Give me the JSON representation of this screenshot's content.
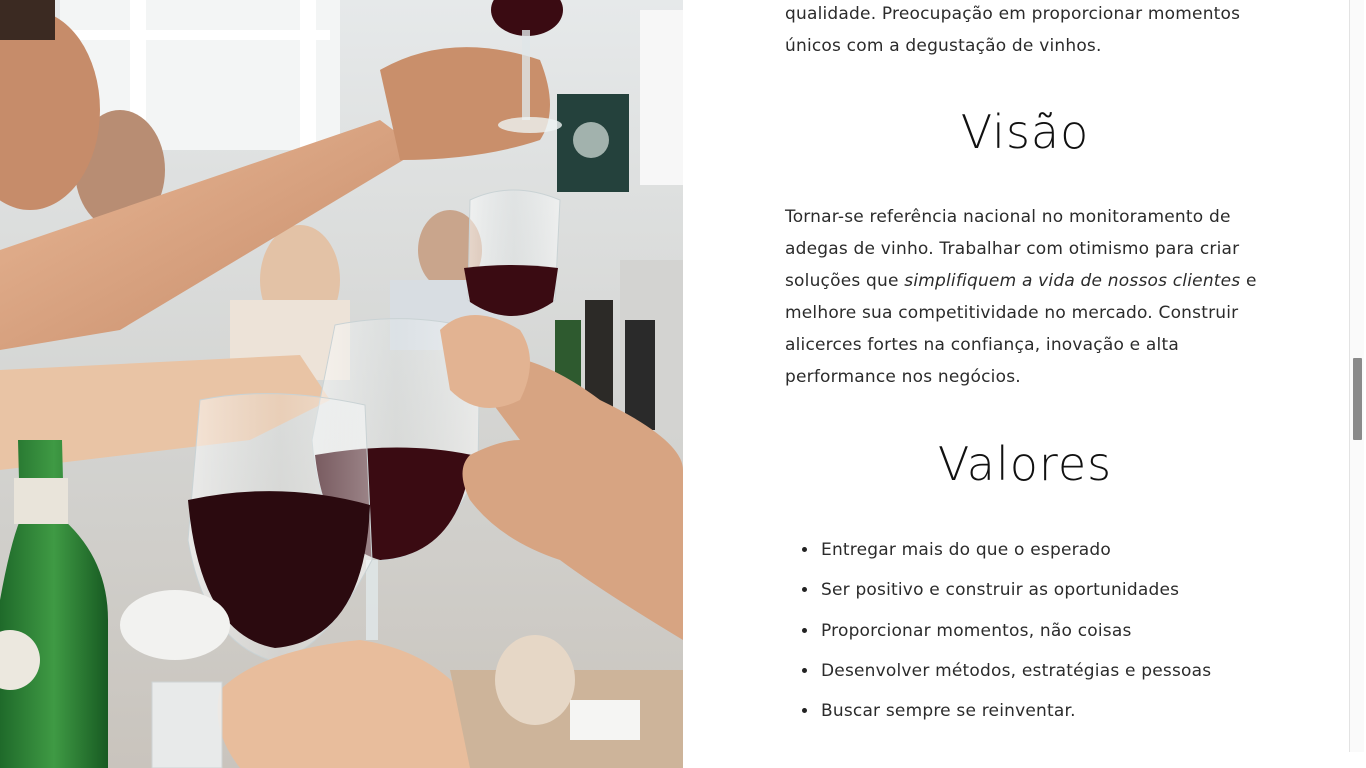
{
  "photo": {
    "alt_name": "wine-toast-photo"
  },
  "intro": {
    "line1": "qualidade. Preocupação em proporcionar momentos",
    "line2": "únicos com a degustação de vinhos."
  },
  "visao": {
    "title": "Visão",
    "text_part1": "Tornar-se referência nacional no monitoramento de adegas de vinho. Trabalhar com otimismo para criar soluções que ",
    "text_emphasis": "simplifiquem a vida de nossos clientes",
    "text_part2": " e melhore sua competitividade no mercado. Construir alicerces fortes na confiança, inovação e alta performance nos negócios."
  },
  "valores": {
    "title": "Valores",
    "items": [
      "Entregar mais do que o esperado",
      "Ser positivo e construir as oportunidades",
      "Proporcionar momentos, não coisas",
      "Desenvolver métodos, estratégias e pessoas",
      "Buscar sempre se reinventar."
    ]
  },
  "colors": {
    "text": "#2b2b2b",
    "heading": "#111111",
    "wine": "#3a0b12"
  }
}
